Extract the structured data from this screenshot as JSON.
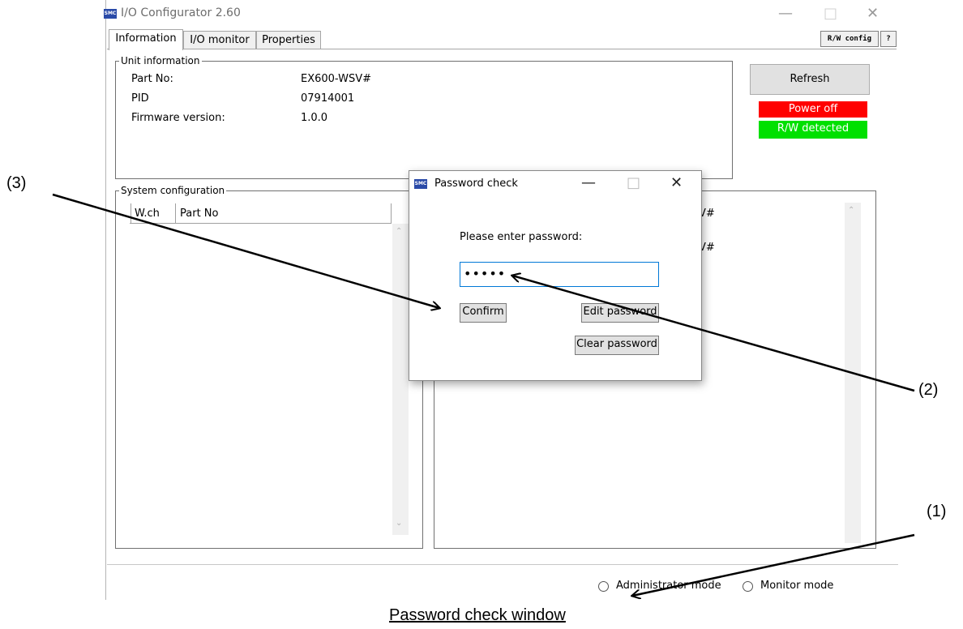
{
  "window": {
    "title": "I/O Configurator 2.60",
    "icon": "smc-app-icon",
    "controls": {
      "minimize": "—",
      "maximize": "□",
      "close": "✕"
    }
  },
  "tabs": [
    "Information",
    "I/O monitor",
    "Properties"
  ],
  "toolbar": {
    "rw_config": "R/W config",
    "help": "?"
  },
  "unit_info": {
    "legend": "Unit information",
    "rows": [
      {
        "label": "Part No:",
        "value": "EX600-WSV#"
      },
      {
        "label": "PID",
        "value": "07914001"
      },
      {
        "label": "Firmware version:",
        "value": "1.0.0"
      }
    ]
  },
  "refresh_label": "Refresh",
  "status": {
    "power": "Power off",
    "rw": "R/W detected",
    "colors": {
      "power": "#ff0000",
      "rw": "#00e000"
    }
  },
  "system_config": {
    "legend": "System configuration",
    "columns": [
      "W.ch",
      "Part No"
    ]
  },
  "right_panel": {
    "partial_1": "V#",
    "partial_2": "V#"
  },
  "dialog": {
    "title": "Password check",
    "controls": {
      "minimize": "—",
      "maximize": "□",
      "close": "✕"
    },
    "prompt": "Please enter password:",
    "password_value": "•••••",
    "confirm": "Confirm",
    "edit_password": "Edit password",
    "clear_password": "Clear password"
  },
  "modes": {
    "admin": "Administrator mode",
    "monitor": "Monitor mode"
  },
  "callouts": {
    "c1": "(1)",
    "c2": "(2)",
    "c3": "(3)"
  },
  "caption": "Password check window"
}
